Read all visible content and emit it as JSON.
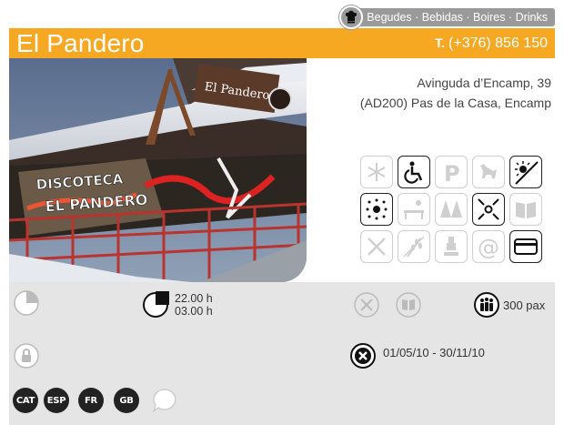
{
  "category": {
    "label": "Begudes · Bebidas · Boires · Drinks",
    "icon": "chef-hat-icon"
  },
  "header": {
    "name": "El Pandero",
    "phone_prefix": "T.",
    "phone": "(+376) 856 150"
  },
  "photo": {
    "sign_text": "DISCOTECA EL PANDERO",
    "roof_sign": "El Pandero"
  },
  "address": {
    "line1": "Avinguda d’Encamp, 39",
    "line2": "(AD200) Pas de la Casa, Encamp"
  },
  "amenities": [
    {
      "icon": "snowflake-icon",
      "active": false
    },
    {
      "icon": "wheelchair-icon",
      "active": true
    },
    {
      "icon": "parking-icon",
      "active": false
    },
    {
      "icon": "dog-icon",
      "active": false
    },
    {
      "icon": "no-smoking-sun-icon",
      "active": true
    },
    {
      "icon": "sun-dots-icon",
      "active": true
    },
    {
      "icon": "terrace-icon",
      "active": false
    },
    {
      "icon": "trees-icon",
      "active": false
    },
    {
      "icon": "expand-arrows-icon",
      "active": true
    },
    {
      "icon": "book-icon",
      "active": false
    },
    {
      "icon": "cutlery-icon",
      "active": false
    },
    {
      "icon": "wheat-icon",
      "active": false
    },
    {
      "icon": "cook-icon",
      "active": false
    },
    {
      "icon": "at-icon",
      "active": false
    },
    {
      "icon": "credit-card-icon",
      "active": true
    }
  ],
  "info": {
    "hours_open": "22.00 h",
    "hours_close": "03.00 h",
    "capacity": "300 pax",
    "closed_period": "01/05/10 - 30/11/10",
    "languages": [
      "CAT",
      "ESP",
      "FR",
      "GB"
    ]
  },
  "colors": {
    "accent": "#f7a823",
    "panel": "#e5e5e5",
    "inactive": "#cfcfcf"
  }
}
